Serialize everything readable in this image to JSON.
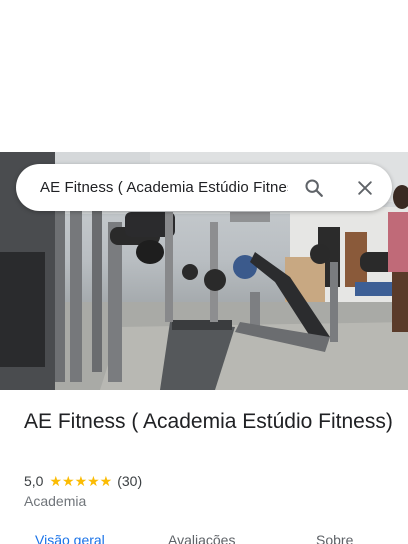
{
  "search": {
    "query": "AE Fitness ( Academia Estúdio Fitness)"
  },
  "place": {
    "name": "AE Fitness ( Academia Estúdio Fitness)",
    "rating": "5,0",
    "stars": "★★★★★",
    "review_count": "(30)",
    "category": "Academia"
  },
  "tabs": [
    "Visão geral",
    "Avaliações",
    "Sobre"
  ],
  "colors": {
    "accent": "#1a73e8",
    "star": "#fbbc04",
    "text": "#202124"
  },
  "icons": [
    "search-icon",
    "close-icon"
  ]
}
